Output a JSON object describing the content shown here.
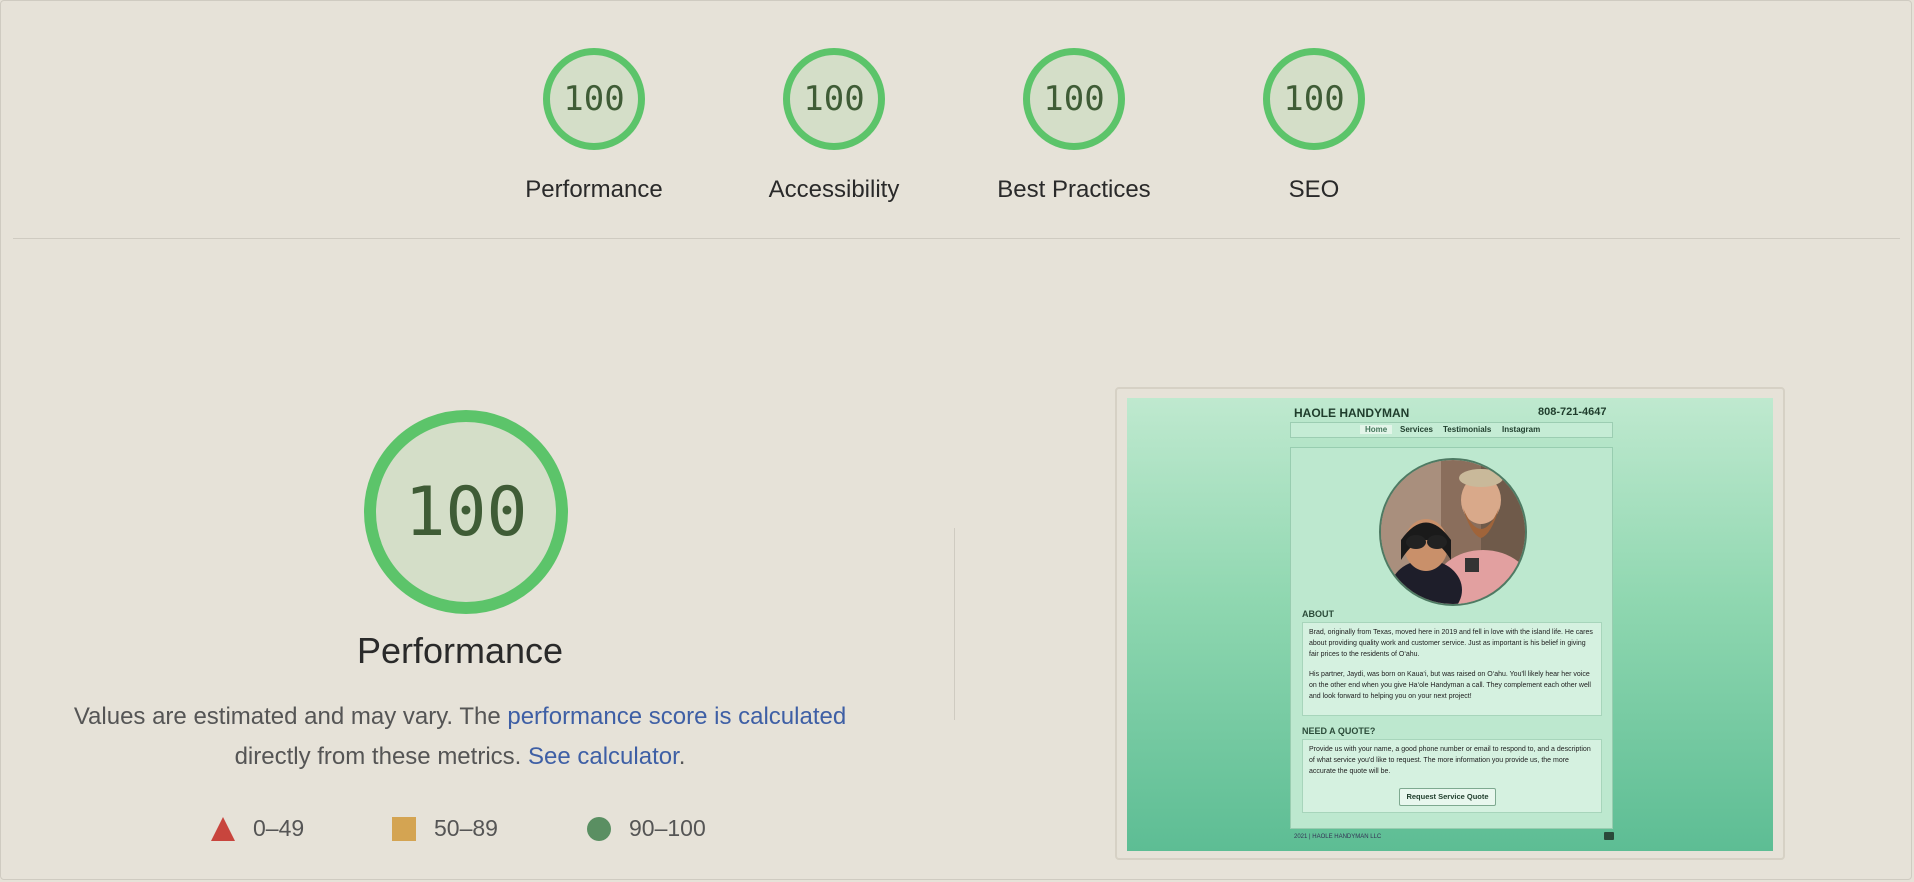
{
  "summary": {
    "categories": [
      {
        "label": "Performance",
        "score": "100"
      },
      {
        "label": "Accessibility",
        "score": "100"
      },
      {
        "label": "Best Practices",
        "score": "100"
      },
      {
        "label": "SEO",
        "score": "100"
      }
    ]
  },
  "performance": {
    "score": "100",
    "title": "Performance",
    "desc_prefix": "Values are estimated and may vary. The ",
    "desc_link": "performance score is calculated",
    "desc_middle": " directly from these metrics. ",
    "calc_link": "See calculator",
    "desc_suffix": "."
  },
  "legend": [
    {
      "shape": "triangle-icon",
      "range": "0–49",
      "color": "#c8453d"
    },
    {
      "shape": "square-icon",
      "range": "50–89",
      "color": "#d4a452"
    },
    {
      "shape": "circle-icon",
      "range": "90–100",
      "color": "#5a8f62"
    }
  ],
  "screenshot": {
    "site_title": "HAOLE HANDYMAN",
    "site_phone": "808-721-4647",
    "nav": [
      "Home",
      "Services",
      "Testimonials",
      "Instagram"
    ],
    "about_heading": "ABOUT",
    "about_p1": "Brad, originally from Texas, moved here in 2019 and fell in love with the island life. He cares about providing quality work and customer service. Just as important is his belief in giving fair prices to the residents of O‘ahu.",
    "about_p2": "His partner, Jaydi, was born on Kaua‘i, but was raised on O‘ahu. You'll likely hear her voice on the other end when you give Ha‘ole Handyman a call. They complement each other well and look forward to helping you on your next project!",
    "quote_heading": "NEED A QUOTE?",
    "quote_text": "Provide us with your name, a good phone number or email to respond to, and a description of what service you'd like to request. The more information you provide us, the more accurate the quote will be.",
    "quote_button": "Request Service Quote",
    "footer": "2021 | HAOLE HANDYMAN LLC"
  }
}
